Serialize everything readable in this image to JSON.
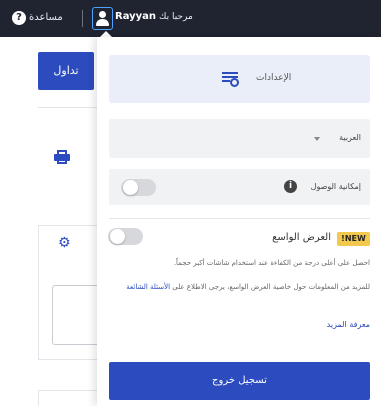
{
  "topbar": {
    "help_label": "مساعدة",
    "help_icon": "?",
    "username": "Rayyan",
    "greeting": "مرحبا بك"
  },
  "background": {
    "trade_button": "تداول"
  },
  "menu": {
    "settings_label": "الإعدادات",
    "language_value": "العربية",
    "accessibility_label": "إمكانية الوصول",
    "info_icon": "i",
    "wide_view": {
      "badge": "!NEW",
      "title": "العرض الواسع",
      "desc1": "احصل على أعلى درجة من الكفاءة عند استخدام شاشات أكبر حجماً.",
      "desc2": "للمزيد من المعلومات حول خاصية العرض الواسع، يرجى الاطلاع على",
      "faq_link": "الأسئلة الشائعة",
      "learn_more": "معرفة المزيد"
    },
    "logout_button": "تسجيل خروج"
  },
  "colors": {
    "topbar_bg": "#1f2430",
    "primary": "#2b4bbf",
    "badge": "#f2c94c",
    "panel_highlight": "#e9eef8"
  },
  "icons": [
    "help-icon",
    "user-icon",
    "settings-icon",
    "printer-icon",
    "gear-icon",
    "info-icon",
    "chevron-down-icon"
  ]
}
